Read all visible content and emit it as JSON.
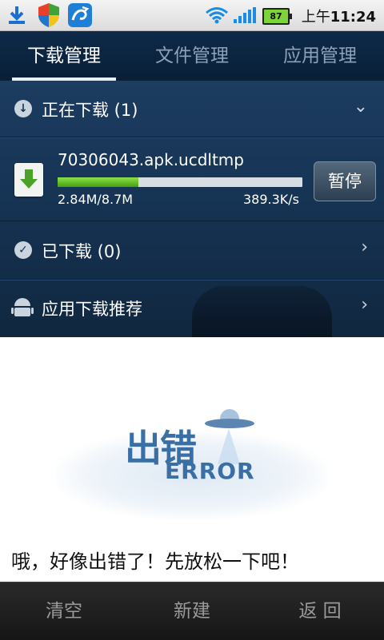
{
  "status_bar": {
    "time_prefix": "上午",
    "time": "11:24",
    "battery_level": "87",
    "icons": [
      "download-icon",
      "shield-icon",
      "app-icon",
      "wifi-icon",
      "signal-icon",
      "battery-icon"
    ]
  },
  "tabs": [
    {
      "label": "下载管理",
      "active": true
    },
    {
      "label": "文件管理",
      "active": false
    },
    {
      "label": "应用管理",
      "active": false
    }
  ],
  "downloading": {
    "header": "正在下载 (1)",
    "item": {
      "filename": "70306043.apk.ucdltmp",
      "size": "2.84M/8.7M",
      "speed": "389.3K/s",
      "progress_fraction": 0.33,
      "pause_label": "暂停"
    }
  },
  "downloaded": {
    "header": "已下载 (0)"
  },
  "recommend": {
    "header": "应用下载推荐"
  },
  "error": {
    "image_text_cn": "出错",
    "image_text_en": "ERROR",
    "message": "哦，好像出错了！先放松一下吧！"
  },
  "bottom_bar": {
    "clear": "清空",
    "new": "新建",
    "back": "返 回"
  },
  "colors": {
    "header_bg": "#0d2a49",
    "panel_bg": "#173556",
    "progress_green": "#43a10e",
    "error_blue": "#3a6fa6",
    "bottom_bg": "#1c1c1c"
  }
}
